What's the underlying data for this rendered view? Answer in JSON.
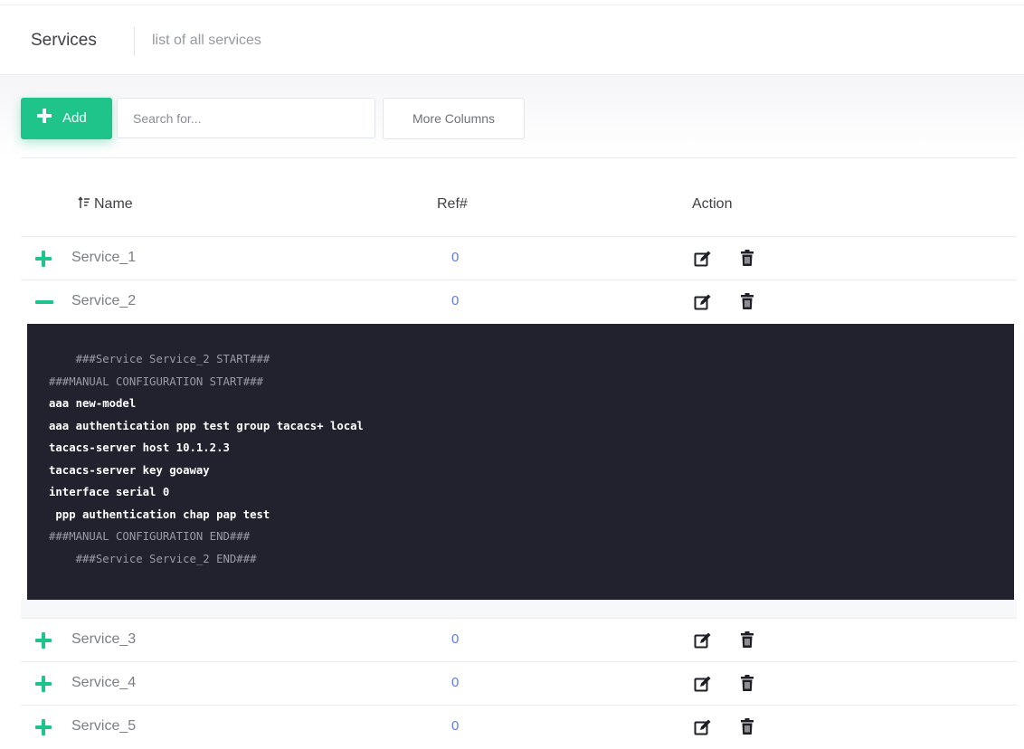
{
  "subheader": {
    "title": "Services",
    "description": "list of all services"
  },
  "toolbar": {
    "add_label": "Add",
    "search_placeholder": "Search for...",
    "more_columns_label": "More Columns"
  },
  "table": {
    "columns": [
      "Name",
      "Ref#",
      "Action"
    ],
    "rows": [
      {
        "name": "Service_1",
        "ref": "0",
        "expanded": false
      },
      {
        "name": "Service_2",
        "ref": "0",
        "expanded": true
      },
      {
        "name": "Service_3",
        "ref": "0",
        "expanded": false
      },
      {
        "name": "Service_4",
        "ref": "0",
        "expanded": false
      },
      {
        "name": "Service_5",
        "ref": "0",
        "expanded": false
      }
    ],
    "icons": {
      "sort": "sort-icon",
      "expand": "plus-icon",
      "collapse": "minus-icon",
      "edit": "edit-icon",
      "delete": "trash-icon"
    }
  },
  "config": {
    "lines": [
      {
        "text": "    ###Service Service_2 START###",
        "style": "cmt"
      },
      {
        "text": "###MANUAL CONFIGURATION START###",
        "style": "cmt"
      },
      {
        "text": "aaa new-model",
        "style": "cmd"
      },
      {
        "text": "aaa authentication ppp test group tacacs+ local",
        "style": "cmd"
      },
      {
        "text": "tacacs-server host 10.1.2.3",
        "style": "cmd"
      },
      {
        "text": "tacacs-server key goaway",
        "style": "cmd"
      },
      {
        "text": "interface serial 0",
        "style": "cmd"
      },
      {
        "text": " ppp authentication chap pap test",
        "style": "cmd"
      },
      {
        "text": "###MANUAL CONFIGURATION END###",
        "style": "cmt"
      },
      {
        "text": "    ###Service Service_2 END###",
        "style": "cmt"
      }
    ]
  },
  "colors": {
    "accent_green": "#1fc48b",
    "link_blue": "#5d78ff",
    "code_bg": "#22212e"
  }
}
